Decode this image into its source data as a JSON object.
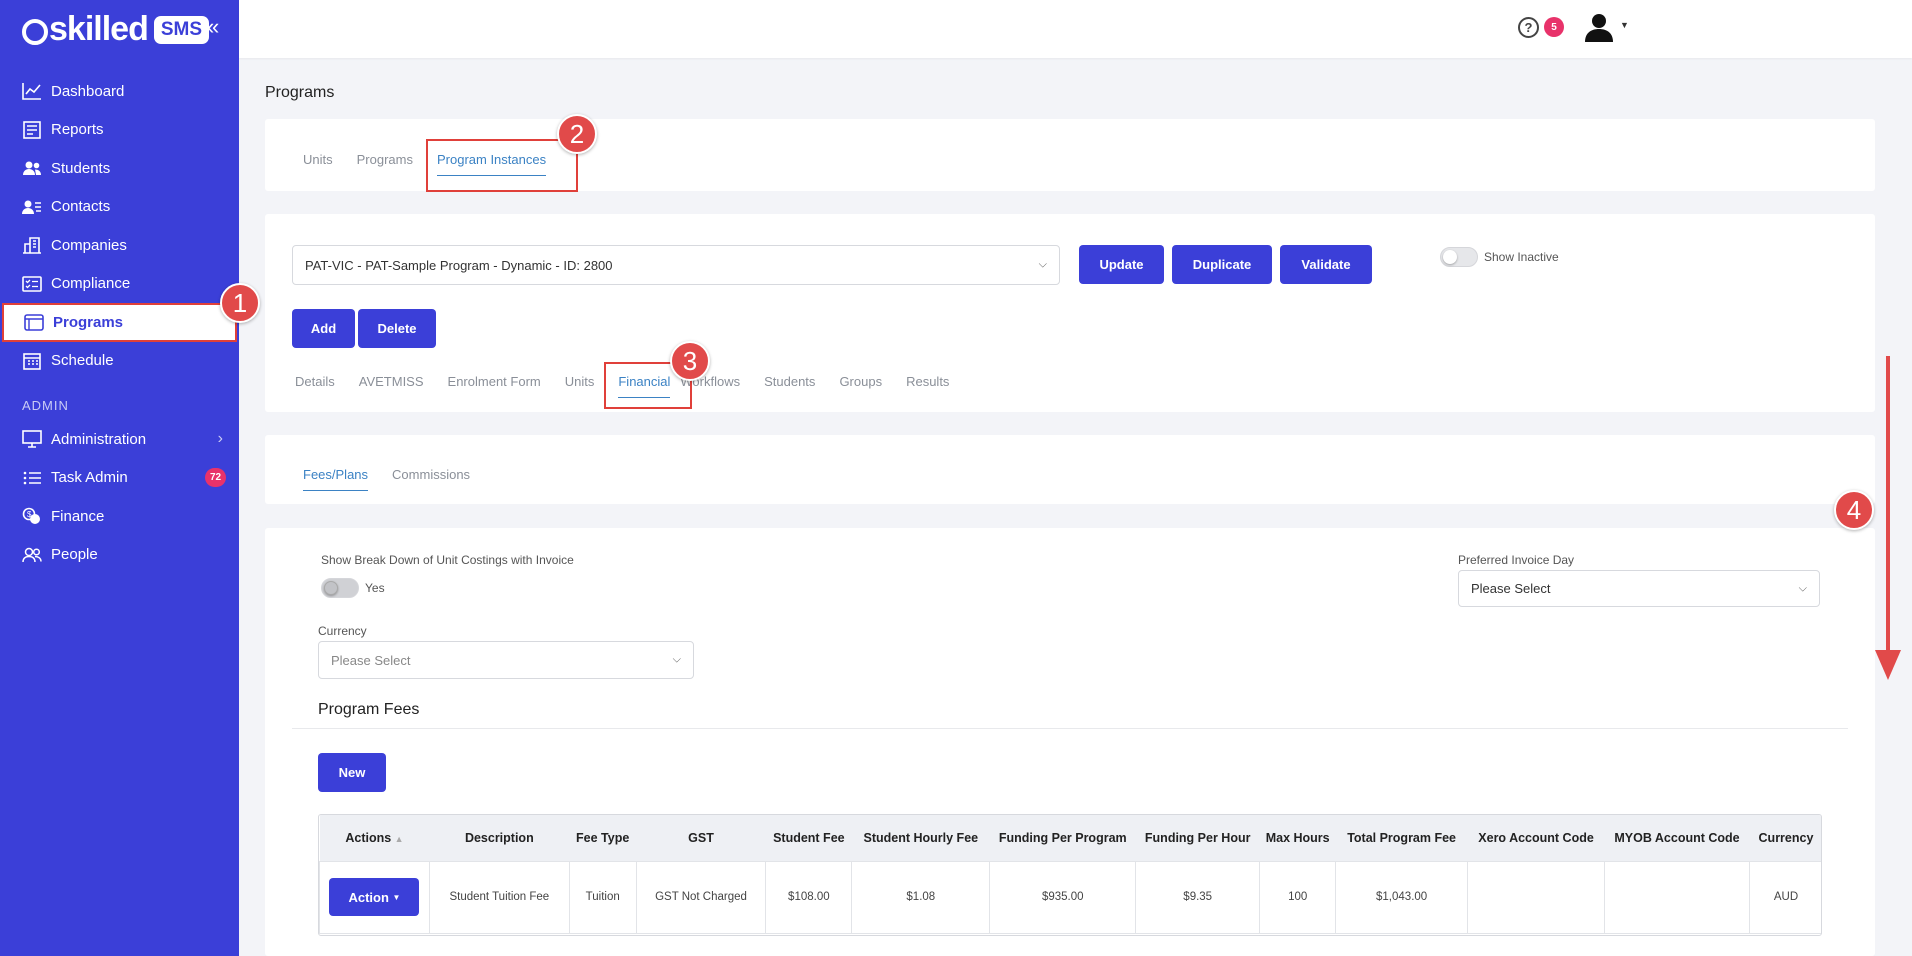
{
  "app": {
    "brand": "skilled",
    "brand_badge": "SMS"
  },
  "sidebar": {
    "items": [
      {
        "label": "Dashboard",
        "icon": "chart-line-icon"
      },
      {
        "label": "Reports",
        "icon": "report-icon"
      },
      {
        "label": "Students",
        "icon": "users-icon"
      },
      {
        "label": "Contacts",
        "icon": "contacts-icon"
      },
      {
        "label": "Companies",
        "icon": "building-icon"
      },
      {
        "label": "Compliance",
        "icon": "checklist-icon"
      },
      {
        "label": "Programs",
        "icon": "window-icon",
        "active": true
      },
      {
        "label": "Schedule",
        "icon": "calendar-icon"
      }
    ],
    "section_admin": "ADMIN",
    "admin_items": [
      {
        "label": "Administration",
        "icon": "monitor-icon"
      },
      {
        "label": "Task Admin",
        "icon": "list-icon",
        "badge": "72"
      },
      {
        "label": "Finance",
        "icon": "coins-icon"
      },
      {
        "label": "People",
        "icon": "people-icon"
      }
    ]
  },
  "topbar": {
    "help_badge": "5"
  },
  "page": {
    "title": "Programs"
  },
  "top_tabs": [
    "Units",
    "Programs",
    "Program Instances"
  ],
  "instance": {
    "selected": "PAT-VIC - PAT-Sample Program - Dynamic - ID: 2800",
    "update": "Update",
    "duplicate": "Duplicate",
    "validate": "Validate",
    "show_inactive": "Show Inactive",
    "add": "Add",
    "delete": "Delete"
  },
  "sub_tabs": [
    "Details",
    "AVETMISS",
    "Enrolment Form",
    "Units",
    "Financial",
    "Workflows",
    "Students",
    "Groups",
    "Results"
  ],
  "fin_tabs": [
    "Fees/Plans",
    "Commissions"
  ],
  "fees": {
    "breakdown_label": "Show Break Down of Unit Costings with Invoice",
    "breakdown_value": "Yes",
    "invoice_day_label": "Preferred Invoice Day",
    "invoice_day_value": "Please Select",
    "currency_label": "Currency",
    "currency_placeholder": "Please Select",
    "program_fees_title": "Program Fees",
    "new_button": "New"
  },
  "table": {
    "headers": [
      "Actions",
      "Description",
      "Fee Type",
      "GST",
      "Student Fee",
      "Student Hourly Fee",
      "Funding Per Program",
      "Funding Per Hour",
      "Max Hours",
      "Total Program Fee",
      "Xero Account Code",
      "MYOB Account Code",
      "Currency"
    ],
    "rows": [
      {
        "action": "Action",
        "description": "Student Tuition Fee",
        "fee_type": "Tuition",
        "gst": "GST Not Charged",
        "student_fee": "$108.00",
        "hourly_fee": "$1.08",
        "funding_program": "$935.00",
        "funding_hour": "$9.35",
        "max_hours": "100",
        "total_fee": "$1,043.00",
        "xero": "",
        "myob": "",
        "currency": "AUD"
      }
    ]
  },
  "steps": [
    "1",
    "2",
    "3",
    "4"
  ],
  "colors": {
    "primary": "#3b3fd8",
    "accent_tab": "#3b82c4",
    "badge": "#e8326a",
    "annotation": "#e14a4a"
  }
}
